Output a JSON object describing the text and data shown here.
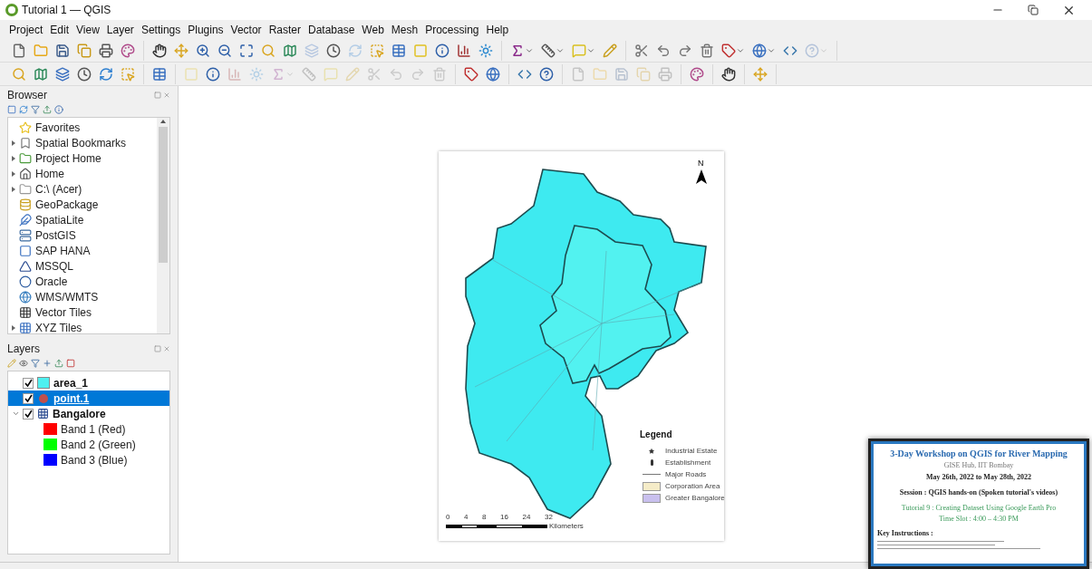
{
  "window": {
    "title": "Tutorial 1 — QGIS"
  },
  "menu": [
    {
      "label": "Project"
    },
    {
      "label": "Edit"
    },
    {
      "label": "View"
    },
    {
      "label": "Layer"
    },
    {
      "label": "Settings"
    },
    {
      "label": "Plugins"
    },
    {
      "label": "Vector"
    },
    {
      "label": "Raster"
    },
    {
      "label": "Database"
    },
    {
      "label": "Web"
    },
    {
      "label": "Mesh"
    },
    {
      "label": "Processing"
    },
    {
      "label": "Help"
    }
  ],
  "toolbars": [
    {
      "groups": [
        [
          {
            "disabled": false,
            "dropdown": false
          },
          {
            "disabled": false,
            "dropdown": false
          },
          {
            "disabled": false,
            "dropdown": false
          },
          {
            "disabled": false,
            "dropdown": false
          },
          {
            "disabled": false,
            "dropdown": false
          },
          {
            "disabled": false,
            "dropdown": false
          }
        ],
        [
          {
            "disabled": false,
            "dropdown": false
          },
          {
            "disabled": false,
            "dropdown": false
          },
          {
            "disabled": false,
            "dropdown": false
          },
          {
            "disabled": false,
            "dropdown": false
          },
          {
            "disabled": false,
            "dropdown": false
          },
          {
            "disabled": false,
            "dropdown": false
          },
          {
            "disabled": false,
            "dropdown": false
          },
          {
            "disabled": true,
            "dropdown": false
          },
          {
            "disabled": false,
            "dropdown": false
          },
          {
            "disabled": true,
            "dropdown": false
          },
          {
            "disabled": false,
            "dropdown": false
          },
          {
            "disabled": false,
            "dropdown": false
          },
          {
            "disabled": false,
            "dropdown": false
          },
          {
            "disabled": false,
            "dropdown": false
          },
          {
            "disabled": false,
            "dropdown": false
          },
          {
            "disabled": false,
            "dropdown": false
          }
        ],
        [
          {
            "disabled": false,
            "dropdown": true
          },
          {
            "disabled": false,
            "dropdown": true
          },
          {
            "disabled": false,
            "dropdown": true
          },
          {
            "disabled": false,
            "dropdown": false
          }
        ],
        [
          {
            "disabled": false,
            "dropdown": false
          },
          {
            "disabled": false,
            "dropdown": false
          },
          {
            "disabled": false,
            "dropdown": false
          },
          {
            "disabled": false,
            "dropdown": false
          },
          {
            "disabled": false,
            "dropdown": true
          },
          {
            "disabled": false,
            "dropdown": true
          },
          {
            "disabled": false,
            "dropdown": false
          },
          {
            "disabled": true,
            "dropdown": true
          }
        ]
      ]
    },
    {
      "groups": [
        [
          {
            "disabled": false,
            "dropdown": false
          },
          {
            "disabled": false,
            "dropdown": false
          },
          {
            "disabled": false,
            "dropdown": false
          },
          {
            "disabled": false,
            "dropdown": false
          },
          {
            "disabled": false,
            "dropdown": false
          },
          {
            "disabled": false,
            "dropdown": false
          }
        ],
        [
          {
            "disabled": false,
            "dropdown": false
          }
        ],
        [
          {
            "disabled": true,
            "dropdown": false
          },
          {
            "disabled": false,
            "dropdown": false
          },
          {
            "disabled": true,
            "dropdown": false
          },
          {
            "disabled": true,
            "dropdown": false
          },
          {
            "disabled": true,
            "dropdown": true
          },
          {
            "disabled": true,
            "dropdown": false
          },
          {
            "disabled": true,
            "dropdown": false
          },
          {
            "disabled": true,
            "dropdown": false
          },
          {
            "disabled": true,
            "dropdown": false
          },
          {
            "disabled": true,
            "dropdown": false
          },
          {
            "disabled": true,
            "dropdown": false
          },
          {
            "disabled": true,
            "dropdown": false
          }
        ],
        [
          {
            "disabled": false,
            "dropdown": false
          },
          {
            "disabled": false,
            "dropdown": false
          }
        ],
        [
          {
            "disabled": false,
            "dropdown": false
          },
          {
            "disabled": false,
            "dropdown": false
          }
        ],
        [
          {
            "disabled": true,
            "dropdown": false
          },
          {
            "disabled": true,
            "dropdown": false
          },
          {
            "disabled": true,
            "dropdown": false
          },
          {
            "disabled": true,
            "dropdown": false
          },
          {
            "disabled": true,
            "dropdown": false
          }
        ],
        [
          {
            "disabled": false,
            "dropdown": false
          }
        ],
        [
          {
            "disabled": false,
            "dropdown": false
          }
        ],
        [
          {
            "disabled": false,
            "dropdown": false
          }
        ]
      ]
    }
  ],
  "browser": {
    "title": "Browser",
    "items": [
      {
        "label": "Favorites",
        "kind": "leaf"
      },
      {
        "label": "Spatial Bookmarks",
        "kind": "expandable"
      },
      {
        "label": "Project Home",
        "kind": "expandable"
      },
      {
        "label": "Home",
        "kind": "expandable"
      },
      {
        "label": "C:\\ (Acer)",
        "kind": "expandable"
      },
      {
        "label": "GeoPackage",
        "kind": "leaf"
      },
      {
        "label": "SpatiaLite",
        "kind": "leaf"
      },
      {
        "label": "PostGIS",
        "kind": "leaf"
      },
      {
        "label": "SAP HANA",
        "kind": "leaf"
      },
      {
        "label": "MSSQL",
        "kind": "leaf"
      },
      {
        "label": "Oracle",
        "kind": "leaf"
      },
      {
        "label": "WMS/WMTS",
        "kind": "leaf"
      },
      {
        "label": "Vector Tiles",
        "kind": "leaf"
      },
      {
        "label": "XYZ Tiles",
        "kind": "expandable"
      }
    ]
  },
  "layers": {
    "title": "Layers",
    "items": [
      {
        "label": "area_1",
        "kind": "polygon",
        "checked": true,
        "selected": false,
        "color": "#4ef0f0"
      },
      {
        "label": "point.1",
        "kind": "point",
        "checked": true,
        "selected": true,
        "color": "#c0504d"
      },
      {
        "label": "Bangalore",
        "kind": "raster",
        "checked": true,
        "selected": false,
        "expanded": true,
        "children": [
          {
            "label": "Band 1 (Red)",
            "color": "#ff0000"
          },
          {
            "label": "Band 2 (Green)",
            "color": "#00ff00"
          },
          {
            "label": "Band 3 (Blue)",
            "color": "#0000ff"
          }
        ]
      }
    ]
  },
  "map_layout": {
    "legend": {
      "title": "Legend",
      "items": [
        {
          "label": "Industrial Estate",
          "kind": "star"
        },
        {
          "label": "Establishment",
          "kind": "pin"
        },
        {
          "label": "Major Roads",
          "kind": "line"
        },
        {
          "label": "Corporation Area",
          "kind": "fill",
          "color": "#f5ecc8"
        },
        {
          "label": "Greater Bangalore",
          "kind": "fill",
          "color": "#c9c0ee"
        }
      ]
    },
    "north_label": "N",
    "scale_ticks": [
      "0",
      "4",
      "8",
      "16",
      "24",
      "32"
    ],
    "scale_unit": "Kilometers"
  },
  "overlay": {
    "title": "3-Day Workshop on QGIS for River Mapping",
    "subtitle": "GISE Hub, IIT Bombay",
    "dates": "May 26th, 2022 to May 28th, 2022",
    "session": "Session : QGIS hands-on (Spoken tutorial's videos)",
    "tutorial": "Tutorial 9 : Creating Dataset Using Google Earth Pro",
    "time": "Time Slot : 4:00 – 4:30 PM",
    "instructions_heading": "Key Instructions :"
  }
}
